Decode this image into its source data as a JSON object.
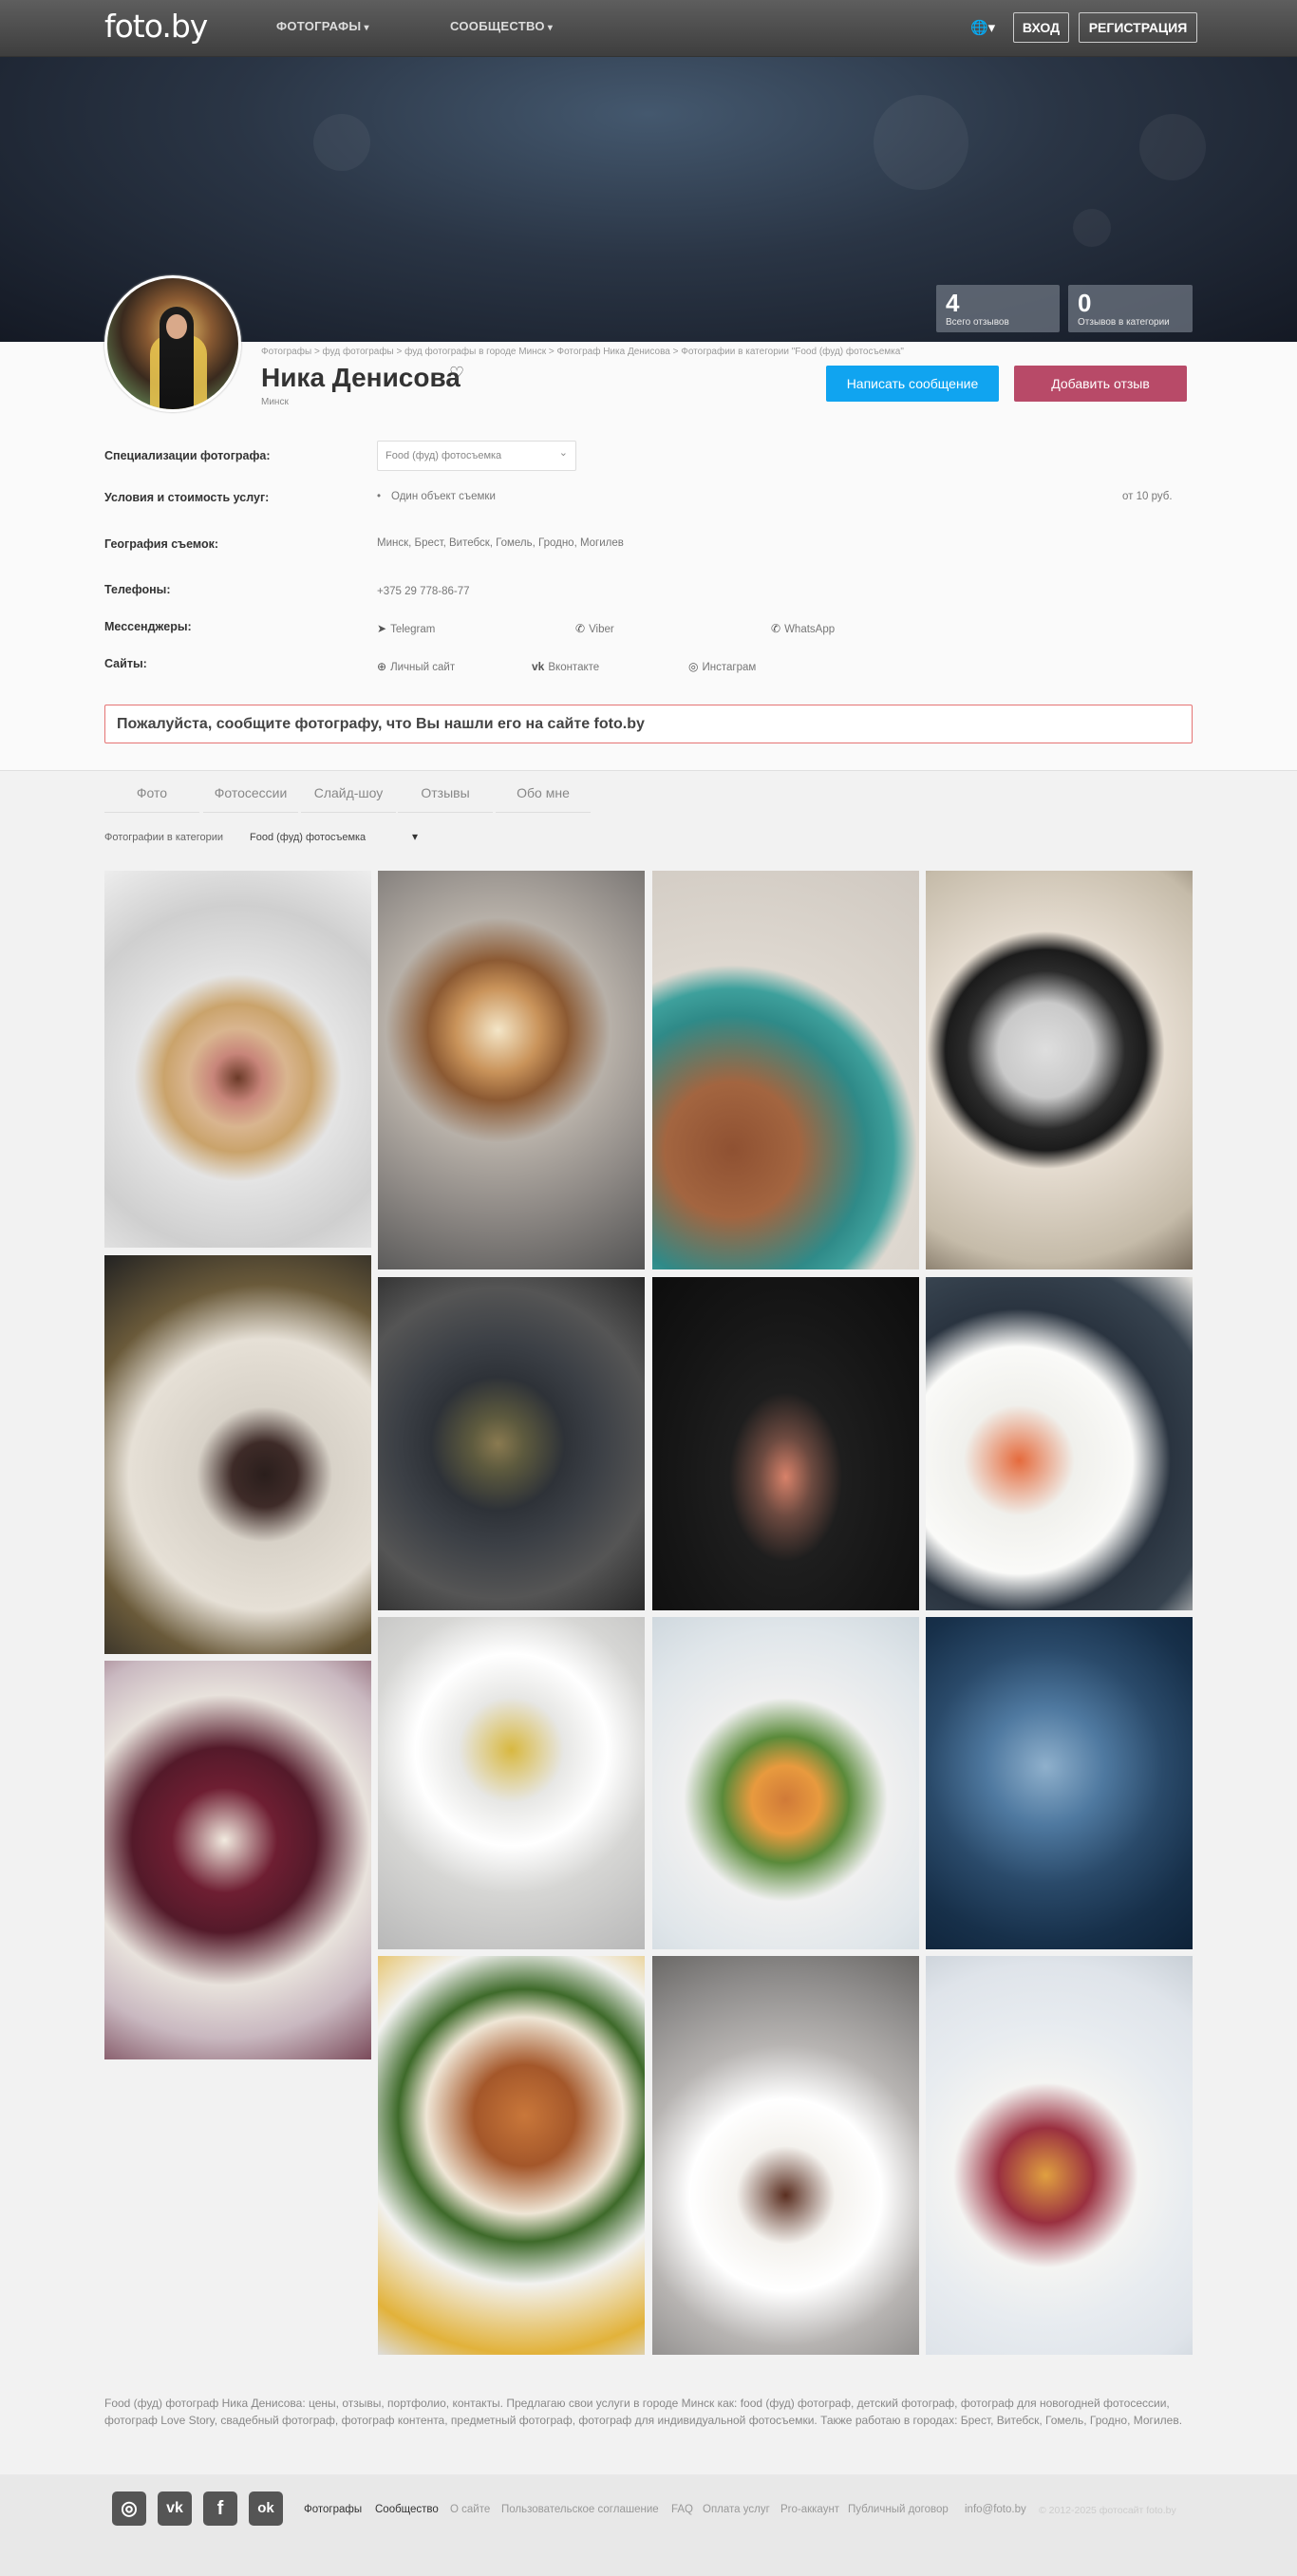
{
  "nav": {
    "logo": "foto.by",
    "menu": [
      "ФОТОГРАФЫ",
      "СООБЩЕСТВО"
    ],
    "login": "ВХОД",
    "register": "РЕГИСТРАЦИЯ",
    "globe_icon": "globe-icon"
  },
  "stats": [
    {
      "value": "4",
      "label": "Всего отзывов"
    },
    {
      "value": "0",
      "label": "Отзывов в категории"
    }
  ],
  "breadcrumb": "Фотографы > фуд фотографы > фуд фотографы в городе Минск > Фотограф Ника Денисова > Фотографии в категории \"Food (фуд) фотосъемка\"",
  "profile": {
    "name": "Ника Денисова",
    "heart": "♡",
    "city": "Минск",
    "message_btn": "Написать сообщение",
    "review_btn": "Добавить отзыв"
  },
  "info": {
    "spec_label": "Специализации фотографа:",
    "spec_value": "Food (фуд) фотосъемка",
    "terms_label": "Условия и стоимость услуг:",
    "terms_item": "Один объект съемки",
    "terms_price": "от 10 руб.",
    "geo_label": "География съемок:",
    "geo_value": "Минск, Брест, Витебск, Гомель, Гродно, Могилев",
    "phones_label": "Телефоны:",
    "phone": "+375 29 778-86-77",
    "messengers_label": "Мессенджеры:",
    "messengers": [
      "Telegram",
      "Viber",
      "WhatsApp"
    ],
    "sites_label": "Сайты:",
    "sites": [
      "Личный сайт",
      "Вконтакте",
      "Инстаграм"
    ]
  },
  "notice": "Пожалуйста, сообщите фотографу, что Вы нашли его на сайте foto.by",
  "tabs": [
    "Фото",
    "Фотосессии",
    "Слайд-шоу",
    "Отзывы",
    "Обо мне"
  ],
  "category": {
    "label": "Фотографии в категории",
    "value": "Food (фуд) фотосъемка"
  },
  "description": "Food (фуд) фотограф Ника Денисова: цены, отзывы, портфолио, контакты. Предлагаю свои услуги в городе Минск как: food (фуд) фотограф, детский фотограф, фотограф для новогодней фотосессии, фотограф Love Story, свадебный фотограф, фотограф контента, предметный фотограф, фотограф для индивидуальной фотосъемки. Также работаю в городах: Брест, Витебск, Гомель, Гродно, Могилев.",
  "footer": {
    "social_icons": [
      "instagram-icon",
      "vk-icon",
      "facebook-icon",
      "odnoklassniki-icon"
    ],
    "social_glyphs": [
      "◎",
      "vk",
      "f",
      "ok"
    ],
    "links": [
      "Фотографы",
      "Сообщество",
      "О сайте",
      "Пользовательское соглашение",
      "FAQ",
      "Оплата услуг",
      "Pro-аккаунт",
      "Публичный договор",
      "info@foto.by"
    ],
    "copyright": "© 2012-2025 фотосайт foto.by"
  },
  "colors": {
    "primary_btn": "#10a4f0",
    "review_btn": "#b84a68",
    "notice_border": "#e57373"
  }
}
